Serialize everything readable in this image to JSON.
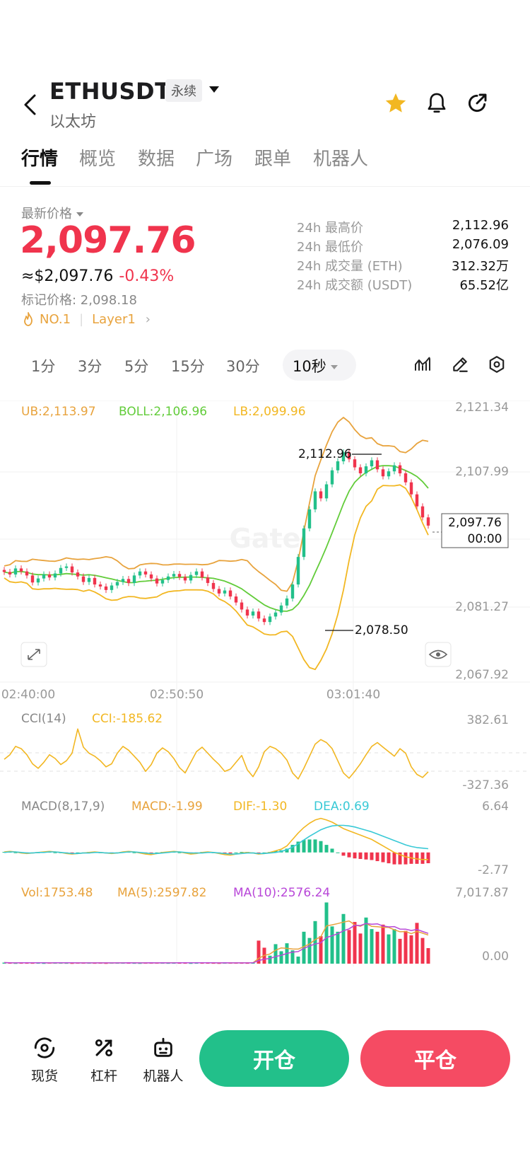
{
  "header": {
    "pair": "ETHUSDT",
    "contract_tag": "永续",
    "subname": "以太坊"
  },
  "tabs": [
    "行情",
    "概览",
    "数据",
    "广场",
    "跟单",
    "机器人"
  ],
  "price": {
    "label": "最新价格",
    "last": "2,097.76",
    "usd": "≈$2,097.76",
    "change": "-0.43%",
    "mark": "标记价格: 2,098.18",
    "rank_tag": "NO.1",
    "sector_tag": "Layer1"
  },
  "stats": [
    {
      "k": "24h 最高价",
      "v": "2,112.96"
    },
    {
      "k": "24h 最低价",
      "v": "2,076.09"
    },
    {
      "k": "24h 成交量 (ETH)",
      "v": "312.32万"
    },
    {
      "k": "24h 成交额 (USDT)",
      "v": "65.52亿"
    }
  ],
  "intervals": [
    "1分",
    "3分",
    "5分",
    "15分",
    "30分"
  ],
  "active_interval": "10秒",
  "colors": {
    "up": "#22c08a",
    "down": "#f0344d",
    "ub": "#e8a33d",
    "boll": "#62cc3a",
    "lb": "#f2b722",
    "dea": "#39c9d6",
    "ma10": "#b847d8"
  },
  "chart_data": {
    "type": "line",
    "main": {
      "legend": {
        "ub": "UB:2,113.97",
        "boll": "BOLL:2,106.96",
        "lb": "LB:2,099.96"
      },
      "y_ticks": [
        "2,121.34",
        "2,107.99",
        "2,081.27",
        "2,067.92"
      ],
      "ylim": [
        2067.92,
        2121.34
      ],
      "high_label": "2,112.96",
      "low_label": "2,078.50",
      "last_price": "2,097.76",
      "countdown": "00:00",
      "x_ticks": [
        "02:40:00",
        "02:50:50",
        "03:01:40"
      ],
      "watermark": "Gate",
      "close_series": [
        2088.5,
        2088.0,
        2089.2,
        2088.6,
        2087.8,
        2086.4,
        2087.2,
        2088.0,
        2087.4,
        2088.2,
        2089.3,
        2089.6,
        2088.4,
        2087.6,
        2086.5,
        2087.3,
        2086.0,
        2085.6,
        2084.9,
        2085.8,
        2086.5,
        2087.1,
        2086.3,
        2087.8,
        2088.6,
        2088.0,
        2087.2,
        2086.2,
        2086.9,
        2087.6,
        2088.1,
        2087.5,
        2086.8,
        2087.9,
        2088.6,
        2087.4,
        2086.3,
        2085.1,
        2084.2,
        2084.8,
        2083.6,
        2082.4,
        2081.0,
        2079.8,
        2080.6,
        2079.2,
        2078.5,
        2079.6,
        2080.4,
        2081.8,
        2083.2,
        2086.0,
        2091.5,
        2097.2,
        2101.0,
        2104.6,
        2103.2,
        2106.0,
        2108.8,
        2110.6,
        2112.4,
        2111.0,
        2109.4,
        2108.2,
        2109.6,
        2110.8,
        2109.0,
        2107.6,
        2108.6,
        2109.8,
        2108.2,
        2106.4,
        2104.0,
        2101.6,
        2099.4,
        2097.76
      ]
    },
    "cci": {
      "label": "CCI(14)",
      "value_label": "CCI:-185.62",
      "ylim": [
        -327.36,
        382.61
      ],
      "y_ticks": [
        "382.61",
        "-327.36"
      ],
      "values": [
        -20,
        40,
        150,
        120,
        40,
        -80,
        -140,
        -60,
        40,
        -10,
        -90,
        -40,
        60,
        380,
        140,
        60,
        20,
        -40,
        -120,
        -80,
        60,
        150,
        100,
        20,
        -60,
        -180,
        -90,
        60,
        130,
        80,
        -10,
        -130,
        -200,
        -60,
        80,
        140,
        60,
        -20,
        -90,
        -180,
        -150,
        -60,
        30,
        -160,
        -250,
        -120,
        80,
        150,
        120,
        60,
        -30,
        -200,
        -280,
        -140,
        20,
        180,
        240,
        200,
        120,
        -40,
        -200,
        -270,
        -180,
        -80,
        40,
        150,
        200,
        140,
        80,
        20,
        120,
        60,
        -120,
        -220,
        -260,
        -185.62
      ]
    },
    "macd": {
      "label": "MACD(8,17,9)",
      "macd_label": "MACD:-1.99",
      "dif_label": "DIF:-1.30",
      "dea_label": "DEA:0.69",
      "ylim": [
        -2.77,
        6.64
      ],
      "y_ticks": [
        "6.64",
        "-2.77"
      ],
      "dif": [
        0.1,
        0.2,
        0.1,
        -0.1,
        -0.2,
        -0.1,
        0.0,
        0.1,
        0.2,
        0.1,
        0.0,
        -0.2,
        -0.3,
        -0.2,
        -0.1,
        0.0,
        0.1,
        0.0,
        -0.1,
        -0.2,
        -0.1,
        0.1,
        0.2,
        0.1,
        -0.1,
        -0.3,
        -0.4,
        -0.2,
        0.0,
        0.1,
        0.2,
        0.1,
        -0.1,
        -0.3,
        -0.2,
        0.0,
        0.1,
        0.0,
        -0.2,
        -0.4,
        -0.5,
        -0.3,
        -0.1,
        0.0,
        -0.1,
        -0.3,
        -0.2,
        0.0,
        0.3,
        0.6,
        1.2,
        2.4,
        3.6,
        4.6,
        5.4,
        6.0,
        6.3,
        6.0,
        5.6,
        5.0,
        4.4,
        4.0,
        3.6,
        3.2,
        2.8,
        2.4,
        1.8,
        1.2,
        0.6,
        0.0,
        -0.4,
        -0.8,
        -1.0,
        -1.2,
        -1.3,
        -1.3
      ],
      "dea": [
        0.0,
        0.1,
        0.1,
        0.0,
        -0.1,
        -0.1,
        0.0,
        0.0,
        0.1,
        0.1,
        0.0,
        -0.1,
        -0.2,
        -0.2,
        -0.1,
        -0.1,
        0.0,
        0.0,
        -0.1,
        -0.1,
        -0.1,
        0.0,
        0.1,
        0.1,
        0.0,
        -0.1,
        -0.2,
        -0.2,
        -0.1,
        0.0,
        0.1,
        0.1,
        0.0,
        -0.1,
        -0.1,
        -0.1,
        0.0,
        0.0,
        -0.1,
        -0.2,
        -0.3,
        -0.3,
        -0.2,
        -0.1,
        -0.1,
        -0.2,
        -0.2,
        -0.1,
        0.0,
        0.2,
        0.5,
        1.0,
        1.6,
        2.3,
        3.0,
        3.6,
        4.2,
        4.6,
        4.9,
        5.0,
        5.0,
        4.9,
        4.7,
        4.4,
        4.1,
        3.8,
        3.4,
        3.0,
        2.6,
        2.2,
        1.8,
        1.4,
        1.1,
        0.9,
        0.8,
        0.69
      ]
    },
    "volume": {
      "vol_label": "Vol:1753.48",
      "ma5_label": "MA(5):2597.82",
      "ma10_label": "MA(10):2576.24",
      "ylim": [
        0,
        7017.87
      ],
      "y_ticks": [
        "7,017.87",
        "0.00"
      ],
      "values": [
        120,
        80,
        60,
        150,
        90,
        70,
        110,
        60,
        80,
        130,
        100,
        70,
        60,
        90,
        120,
        80,
        70,
        100,
        60,
        90,
        110,
        80,
        130,
        70,
        60,
        100,
        120,
        90,
        80,
        70,
        110,
        140,
        90,
        60,
        80,
        100,
        130,
        70,
        60,
        90,
        80,
        120,
        110,
        70,
        100,
        2600,
        1800,
        900,
        2200,
        1400,
        2300,
        1500,
        800,
        3600,
        2900,
        4800,
        3100,
        6900,
        4200,
        3600,
        5600,
        3800,
        4700,
        3400,
        5200,
        3900,
        3600,
        4400,
        3300,
        3900,
        2800,
        3700,
        3200,
        4600,
        2900,
        1753
      ]
    }
  },
  "bottom_nav": [
    "现货",
    "杠杆",
    "机器人"
  ],
  "actions": {
    "open": "开仓",
    "close": "平仓"
  }
}
